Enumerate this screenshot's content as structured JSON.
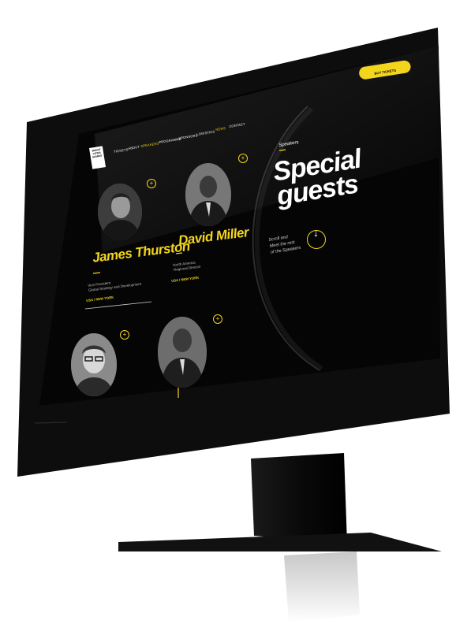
{
  "brand": {
    "logo_lines": [
      "SMART",
      "CITIES",
      "SUMMIT"
    ]
  },
  "nav": {
    "items": [
      {
        "label": "TICKETS",
        "active": false
      },
      {
        "label": "ABOUT",
        "active": false
      },
      {
        "label": "SPEAKERS",
        "active": true
      },
      {
        "label": "PROGRAMME",
        "active": false
      },
      {
        "label": "SPONSORS",
        "active": false
      },
      {
        "label": "LOGISTICS",
        "active": false
      },
      {
        "label": "NEWS",
        "active": false
      },
      {
        "label": "CONTACT",
        "active": false
      }
    ]
  },
  "header": {
    "buy_button": "BUY TICKETS"
  },
  "hero": {
    "eyebrow": "Speakers",
    "title_line1": "Special",
    "title_line2": "guests",
    "scroll_line1": "Scroll and",
    "scroll_line2": "Meet the rest",
    "scroll_line3": "of the Speakers"
  },
  "speakers": [
    {
      "name": "James  Thurston",
      "role_line1": "Vice President",
      "role_line2": "Global Strategy and Development",
      "location": "USA / NEW YORK"
    },
    {
      "name": "David Miller",
      "role_line1": "North America",
      "role_line2": "Regional Director",
      "location": "USA / NEW YORK"
    }
  ],
  "icons": {
    "plus": "+",
    "scroll_arrow": "↓"
  },
  "colors": {
    "accent": "#f3d51e",
    "screen": "#050505",
    "bezel": "#0d0d0d"
  }
}
